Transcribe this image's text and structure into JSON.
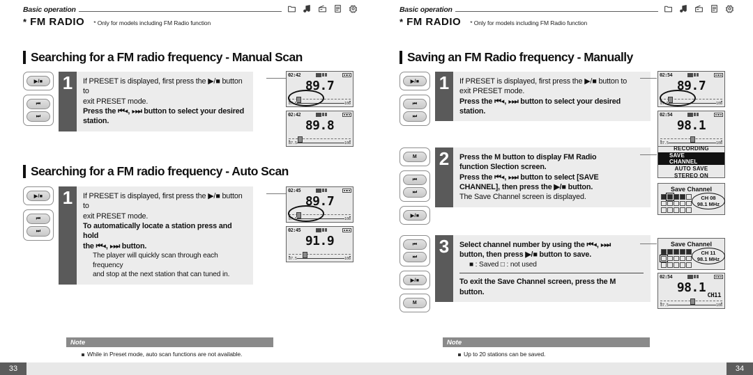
{
  "header": {
    "basic_operation": "Basic operation",
    "star": "*",
    "title": "FM RADIO",
    "subtitle": "* Only for models including FM Radio function",
    "icons": [
      "folder-icon",
      "music-note-icon",
      "radio-icon",
      "text-icon",
      "gear-icon"
    ]
  },
  "left_page": {
    "page_number": "33",
    "section1": {
      "heading": "Searching for a FM radio frequency - Manual Scan",
      "step": {
        "number": "1",
        "buttons": [
          [
            "▶/■"
          ],
          [
            "⏮",
            "⏭"
          ]
        ],
        "lines": [
          {
            "text": "If PRESET is displayed, first press the ▶/■ button to",
            "bold": false
          },
          {
            "text": "exit PRESET mode.",
            "bold": false
          },
          {
            "text": "Press the ⏮◂, ▸⏭ button to select your desired",
            "bold": true
          },
          {
            "text": "station.",
            "bold": true
          }
        ],
        "screens": [
          {
            "time": "02:42",
            "freq": "89.7",
            "scale_left": "87.5",
            "scale_right": "108",
            "knob_pct": 12,
            "highlight": true
          },
          {
            "time": "02:42",
            "freq": "89.8",
            "scale_left": "87.5",
            "scale_right": "108",
            "knob_pct": 15,
            "highlight": false
          }
        ]
      }
    },
    "section2": {
      "heading": "Searching for a FM radio frequency - Auto Scan",
      "step": {
        "number": "1",
        "buttons": [
          [
            "▶/■"
          ],
          [
            "⏮",
            "⏭"
          ]
        ],
        "lines": [
          {
            "text": "If PRESET is displayed, first press the ▶/■ button to",
            "bold": false
          },
          {
            "text": "exit PRESET mode.",
            "bold": false
          },
          {
            "text": "To automatically locate a station press and hold",
            "bold": true
          },
          {
            "text": "the ⏮◂, ▸⏭ button.",
            "bold": true
          },
          {
            "text": "The player will quickly scan through each frequency",
            "bold": false,
            "indent": true
          },
          {
            "text": "and stop at the next station that can tuned in.",
            "bold": false,
            "indent": true
          }
        ],
        "screens": [
          {
            "time": "02:45",
            "freq": "89.7",
            "scale_left": "87.5",
            "scale_right": "108",
            "knob_pct": 12,
            "highlight": true
          },
          {
            "time": "02:45",
            "freq": "91.9",
            "scale_left": "87.5",
            "scale_right": "108",
            "knob_pct": 22,
            "highlight": false
          }
        ]
      }
    },
    "note": {
      "label": "Note",
      "items": [
        "While in Preset mode, auto scan functions are not available."
      ]
    }
  },
  "right_page": {
    "page_number": "34",
    "section1": {
      "heading": "Saving an FM Radio frequency - Manually",
      "steps": [
        {
          "number": "1",
          "buttons": [
            [
              "▶/■"
            ],
            [
              "⏮",
              "⏭"
            ]
          ],
          "lines": [
            {
              "text": "If PRESET is displayed, first press the ▶/■ button to",
              "bold": false
            },
            {
              "text": "exit PRESET mode.",
              "bold": false
            },
            {
              "text": "Press the ⏮◂, ▸⏭ button to select your desired",
              "bold": true
            },
            {
              "text": "station.",
              "bold": true
            }
          ]
        },
        {
          "number": "2",
          "buttons": [
            [
              "M"
            ],
            [
              "⏮",
              "⏭"
            ],
            [
              "▶/■"
            ]
          ],
          "lines": [
            {
              "text": "Press the M  button to display FM Radio",
              "bold": true
            },
            {
              "text": "function Slection screen.",
              "bold": true
            },
            {
              "text": "Press the ⏮◂, ▸⏭ button to select [SAVE",
              "bold": true
            },
            {
              "text": "CHANNEL], then press the ▶/■ button.",
              "bold": true
            },
            {
              "text": "The Save Channel screen is displayed.",
              "bold": false
            }
          ]
        },
        {
          "number": "3",
          "buttons": [
            [
              "⏮",
              "⏭"
            ],
            [
              "▶/■"
            ],
            [
              "M"
            ]
          ],
          "lines": [
            {
              "text": "Select channel number by using the ⏮◂, ▸⏭",
              "bold": true
            },
            {
              "text": "button, then press ▶/■ button to save.",
              "bold": true
            },
            {
              "text": "■ : Saved          □ : not used",
              "bold": false,
              "indent": true
            },
            {
              "rule": true
            },
            {
              "text": "To exit the Save Channel screen, press the M",
              "bold": true
            },
            {
              "text": "button.",
              "bold": true
            }
          ]
        }
      ],
      "screens_step1": [
        {
          "time": "02:54",
          "freq": "89.7",
          "scale_left": "87.5",
          "scale_right": "108",
          "knob_pct": 12,
          "highlight": true
        },
        {
          "time": "02:54",
          "freq": "98.1",
          "scale_left": "87.5",
          "scale_right": "108",
          "knob_pct": 48,
          "highlight": false
        }
      ],
      "menu_screen": {
        "items": [
          "RECORDING",
          "SAVE CHANNEL",
          "AUTO SAVE",
          "STEREO ON"
        ],
        "selected": "SAVE CHANNEL"
      },
      "save_screen_step2": {
        "title": "Save Channel",
        "channel": "CH 08",
        "frequency": "98.1 MHz",
        "cells": [
          1,
          1,
          1,
          1,
          0,
          0,
          0,
          0,
          0,
          0,
          0,
          0,
          0,
          0,
          0
        ],
        "cursor_index": 1
      },
      "save_screen_step3": {
        "title": "Save Channel",
        "channel": "CH 11",
        "frequency": "98.1 MHz",
        "cells": [
          1,
          1,
          1,
          1,
          1,
          0,
          0,
          0,
          0,
          0,
          0,
          0,
          0,
          0,
          0
        ],
        "cursor_index": 5
      },
      "screen_step3_final": {
        "time": "02:54",
        "freq": "98.1",
        "channel": "CH11",
        "scale_left": "87.5",
        "scale_right": "108",
        "knob_pct": 48
      }
    },
    "note": {
      "label": "Note",
      "items": [
        "Up to 20 stations can be saved."
      ]
    }
  }
}
